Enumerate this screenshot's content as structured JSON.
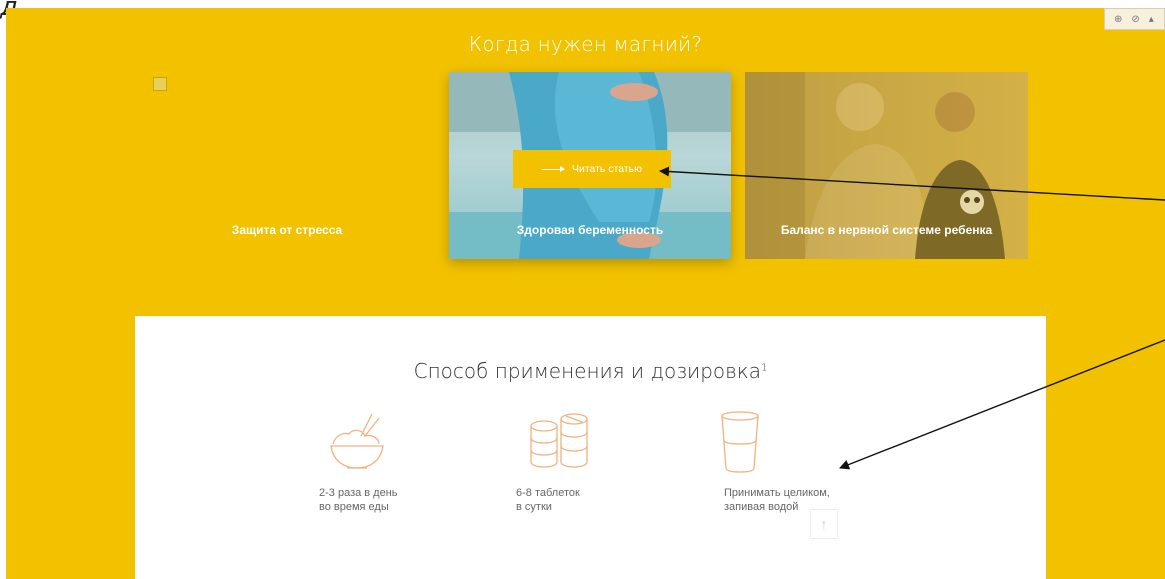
{
  "corner_mark": "д",
  "plugin_bar": {
    "icons": [
      "plus-icon",
      "eye-icon",
      "lock-icon"
    ],
    "glyphs": [
      "⊕",
      "⊘",
      "▴"
    ]
  },
  "hero": {
    "title": "Когда нужен магний?",
    "cards": [
      {
        "label": "Защита от стресса"
      },
      {
        "label": "Здоровая беременность",
        "button": "Читать статью"
      },
      {
        "label": "Баланс в нервной системе ребенка"
      }
    ]
  },
  "dosage": {
    "title": "Способ применения и дозировка",
    "footnote": "1",
    "items": [
      {
        "line1": "2-3 раза в день",
        "line2": "во время еды",
        "icon": "rice-bowl-icon"
      },
      {
        "line1": "6-8 таблеток",
        "line2": "в сутки",
        "icon": "tablets-icon"
      },
      {
        "line1": "Принимать целиком,",
        "line2": "запивая водой",
        "icon": "glass-of-water-icon"
      }
    ],
    "scroll_top_glyph": "↑"
  },
  "colors": {
    "brand_yellow": "#f2c200",
    "icon_orange": "#f2b27e",
    "text_gray": "#666666"
  }
}
